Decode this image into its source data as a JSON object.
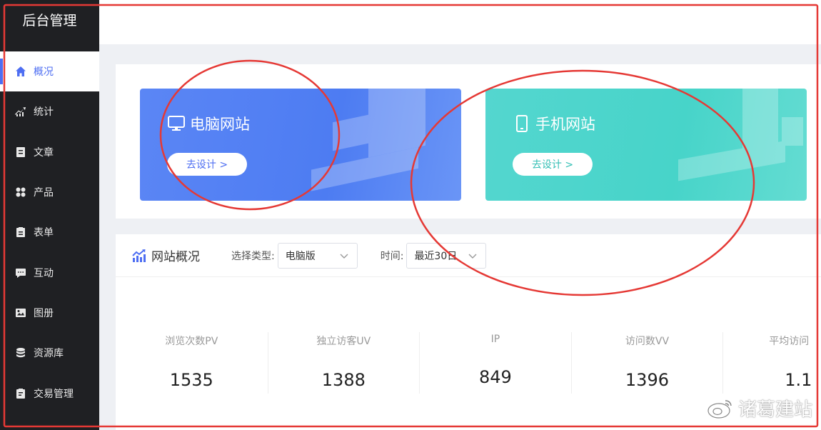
{
  "app": {
    "title": "后台管理"
  },
  "sidebar": {
    "items": [
      {
        "label": "概况",
        "icon": "home-icon",
        "active": true
      },
      {
        "label": "统计",
        "icon": "trend-icon"
      },
      {
        "label": "文章",
        "icon": "document-icon"
      },
      {
        "label": "产品",
        "icon": "grid-icon"
      },
      {
        "label": "表单",
        "icon": "clipboard-icon"
      },
      {
        "label": "互动",
        "icon": "chat-icon"
      },
      {
        "label": "图册",
        "icon": "image-icon"
      },
      {
        "label": "资源库",
        "icon": "database-icon"
      },
      {
        "label": "交易管理",
        "icon": "order-icon"
      }
    ]
  },
  "banners": {
    "pc": {
      "title": "电脑网站",
      "button": "去设计 >",
      "icon": "monitor-icon",
      "color": "#4e7cf2"
    },
    "mobile": {
      "title": "手机网站",
      "button": "去设计 >",
      "icon": "phone-icon",
      "color": "#47d4c9"
    }
  },
  "overview": {
    "title": "网站概况",
    "type_label": "选择类型:",
    "type_value": "电脑版",
    "time_label": "时间:",
    "time_value": "最近30日",
    "stats": [
      {
        "label": "浏览次数PV",
        "value": "1535"
      },
      {
        "label": "独立访客UV",
        "value": "1388"
      },
      {
        "label": "IP",
        "value": "849"
      },
      {
        "label": "访问数VV",
        "value": "1396"
      },
      {
        "label": "平均访问",
        "value": "1.1"
      }
    ]
  },
  "watermark": {
    "text": "诸葛建站",
    "icon": "weibo-icon"
  },
  "colors": {
    "accent": "#4e6ef2",
    "sidebar_bg": "#1f2023",
    "annotation": "#e53935"
  }
}
